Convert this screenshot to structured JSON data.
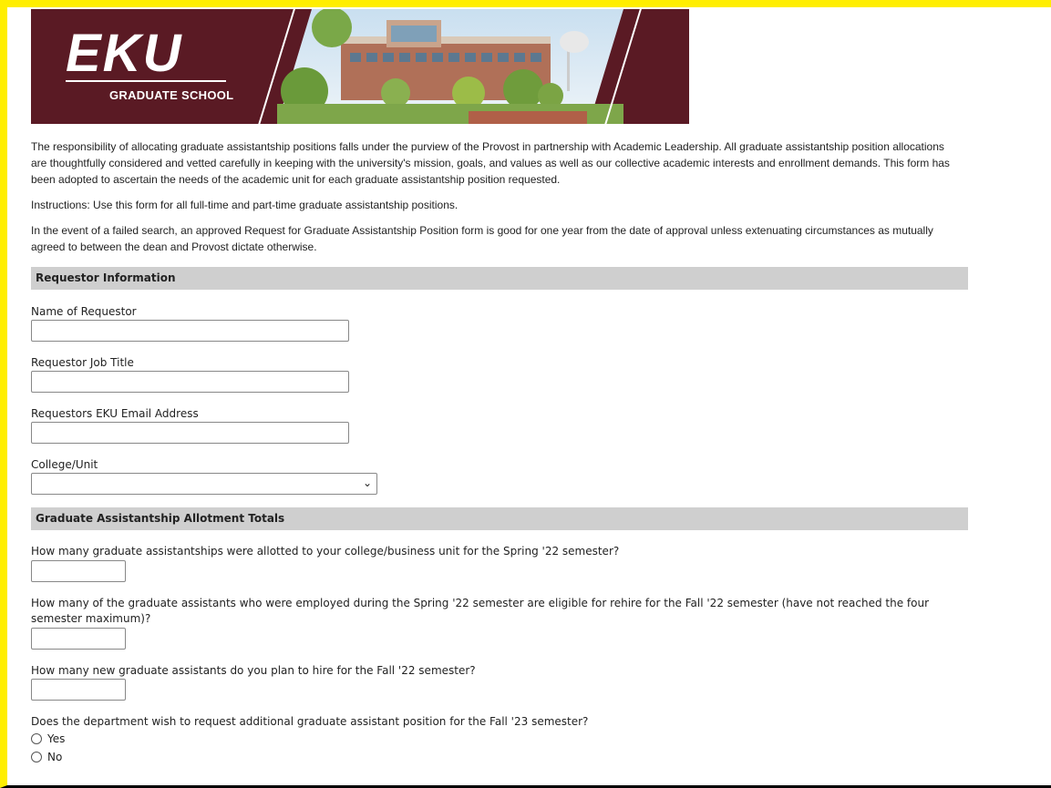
{
  "banner": {
    "logo_text": "EKU",
    "logo_subtitle": "GRADUATE SCHOOL"
  },
  "intro": {
    "paragraph1": "The responsibility of allocating graduate assistantship positions falls under the purview of the Provost in partnership with Academic Leadership. All graduate assistantship position allocations are thoughtfully considered and vetted carefully in keeping with the university's mission, goals, and values as well as our collective academic interests and enrollment demands. This form has been adopted to ascertain the needs of the academic unit for each graduate assistantship position requested.",
    "paragraph2": "Instructions: Use this form for all full-time and part-time graduate assistantship positions.",
    "paragraph3": "In the event of a failed search, an approved Request for Graduate Assistantship Position form is good for one year from the date of approval unless extenuating circumstances as mutually agreed to between the dean and Provost dictate otherwise."
  },
  "requestor_section": {
    "title": "Requestor Information",
    "name_label": "Name of Requestor",
    "name_value": "",
    "job_title_label": "Requestor Job Title",
    "job_title_value": "",
    "email_label": "Requestors EKU Email Address",
    "email_value": "",
    "college_label": "College/Unit",
    "college_value": ""
  },
  "allotment_section": {
    "title": "Graduate Assistantship Allotment Totals",
    "q1_label": "How many graduate assistantships were allotted to your college/business unit for the Spring '22 semester?",
    "q1_value": "",
    "q2_label": "How many of the graduate assistants who were employed during the Spring '22 semester are eligible for rehire for the Fall '22 semester (have not reached the four semester maximum)?",
    "q2_value": "",
    "q3_label": "How many new graduate assistants do you plan to hire for the Fall '22 semester?",
    "q3_value": "",
    "q4_label": "Does the department wish to request additional graduate assistant position for the Fall '23 semester?",
    "q4_options": [
      "Yes",
      "No"
    ]
  },
  "colors": {
    "banner_maroon": "#5a1a24",
    "section_header_bg": "#cfcfcf",
    "frame_yellow": "#ffee00"
  }
}
